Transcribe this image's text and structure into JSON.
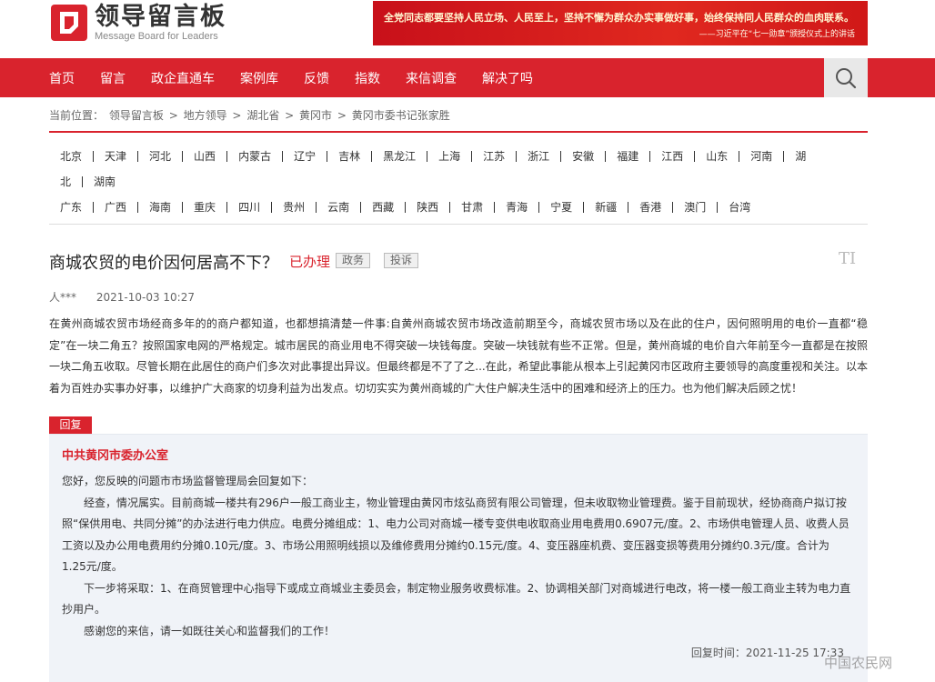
{
  "header": {
    "logo_cn": "领导留言板",
    "logo_en": "Message Board for Leaders",
    "banner_line1": "全党同志都要坚持人民立场、人民至上，坚持不懈为群众办实事做好事，始终保持同人民群众的血肉联系。",
    "banner_line2": "——习近平在“七一勋章”颁授仪式上的讲话"
  },
  "nav": {
    "items": [
      "首页",
      "留言",
      "政企直通车",
      "案例库",
      "反馈",
      "指数",
      "来信调查",
      "解决了吗"
    ],
    "search_icon": "search-icon"
  },
  "breadcrumb": {
    "prefix": "当前位置：",
    "items": [
      "领导留言板",
      "地方领导",
      "湖北省",
      "黄冈市",
      "黄冈市委书记张家胜"
    ],
    "separator": ">"
  },
  "regions": {
    "row1": [
      "北京",
      "天津",
      "河北",
      "山西",
      "内蒙古",
      "辽宁",
      "吉林",
      "黑龙江",
      "上海",
      "江苏",
      "浙江",
      "安徽",
      "福建",
      "江西",
      "山东",
      "河南",
      "湖"
    ],
    "row2": [
      "北",
      "湖南"
    ],
    "row3": [
      "广东",
      "广西",
      "海南",
      "重庆",
      "四川",
      "贵州",
      "云南",
      "西藏",
      "陕西",
      "甘肃",
      "青海",
      "宁夏",
      "新疆",
      "香港",
      "澳门",
      "台湾"
    ]
  },
  "message": {
    "title": "商城农贸的电价因何居高不下？",
    "status": "已办理",
    "tags": [
      "政务",
      "投诉"
    ],
    "font_toggle": "TI",
    "author": "人***",
    "date": "2021-10-03 10:27",
    "content": "在黄州商城农贸市场经商多年的的商户都知道，也都想搞清楚一件事:自黄州商城农贸市场改造前期至今，商城农贸市场以及在此的住户，因何照明用的电价一直都“稳定”在一块二角五？按照国家电网的严格规定。城市居民的商业用电不得突破一块钱每度。突破一块钱就有些不正常。但是，黄州商城的电价自六年前至今一直都是在按照一块二角五收取。尽管长期在此居住的商户们多次对此事提出异议。但最终都是不了了之...在此，希望此事能从根本上引起黄冈市区政府主要领导的高度重视和关注。以本着为百姓办实事办好事，以维护广大商家的切身利益为出发点。切切实实为黄州商城的广大住户解决生活中的困难和经济上的压力。也为他们解决后顾之忧！"
  },
  "reply": {
    "label": "回复",
    "org": "中共黄冈市委办公室",
    "p1": "您好，您反映的问题市市场监督管理局会回复如下：",
    "p2": "经查，情况属实。目前商城一楼共有296户一般工商业主，物业管理由黄冈市炫弘商贸有限公司管理，但未收取物业管理费。鉴于目前现状，经协商商户拟订按照“保供用电、共同分摊”的办法进行电力供应。电费分摊组成：1、电力公司对商城一楼专变供电收取商业用电费用0.6907元/度。2、市场供电管理人员、收费人员工资以及办公用电费用约分摊0.10元/度。3、市场公用照明线损以及维修费用分摊约0.15元/度。4、变压器座机费、变压器变损等费用分摊约0.3元/度。合计为1.25元/度。",
    "p3": "下一步将采取：1、在商贸管理中心指导下或成立商城业主委员会，制定物业服务收费标准。2、协调相关部门对商城进行电改，将一楼一般工商业主转为电力直抄用户。",
    "p4": "感谢您的来信，请一如既往关心和监督我们的工作！",
    "time_label": "回复时间：",
    "time": "2021-11-25 17:33"
  },
  "watermark": "中国农民网",
  "colors": {
    "brand_red": "#d9232d",
    "reply_bg": "#f0f3f8"
  }
}
